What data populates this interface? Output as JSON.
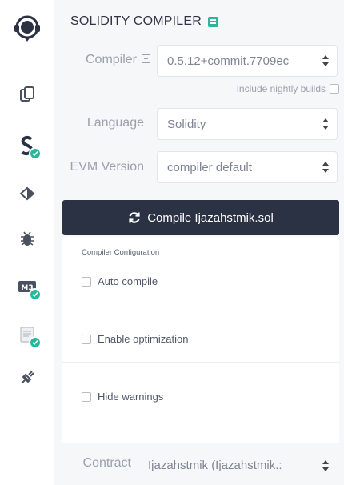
{
  "sidebar": {
    "icons": [
      {
        "name": "remix-logo-icon",
        "check": false
      },
      {
        "name": "file-explorer-icon",
        "check": false
      },
      {
        "name": "solidity-compiler-icon",
        "check": true
      },
      {
        "name": "deploy-run-icon",
        "check": false
      },
      {
        "name": "debugger-icon",
        "check": false
      },
      {
        "name": "plugin-badge-icon",
        "check": true
      },
      {
        "name": "documentation-icon",
        "check": true
      },
      {
        "name": "plugin-manager-icon",
        "check": false
      }
    ]
  },
  "header": {
    "title": "SOLIDITY COMPILER"
  },
  "compiler": {
    "label": "Compiler",
    "value": "0.5.12+commit.7709ec",
    "nightly_label": "Include nightly builds"
  },
  "language": {
    "label": "Language",
    "value": "Solidity"
  },
  "evm": {
    "label": "EVM Version",
    "value": "compiler default"
  },
  "compile_button": {
    "label": "Compile Ijazahstmik.sol"
  },
  "config": {
    "title": "Compiler Configuration",
    "auto_compile": "Auto compile",
    "enable_optimization": "Enable optimization",
    "hide_warnings": "Hide warnings"
  },
  "contract": {
    "label": "Contract",
    "value": "Ijazahstmik (Ijazahstmik.:"
  },
  "colors": {
    "accent": "#29b79a",
    "button_bg": "#2b3243",
    "panel_bg": "#f6f7f9"
  }
}
